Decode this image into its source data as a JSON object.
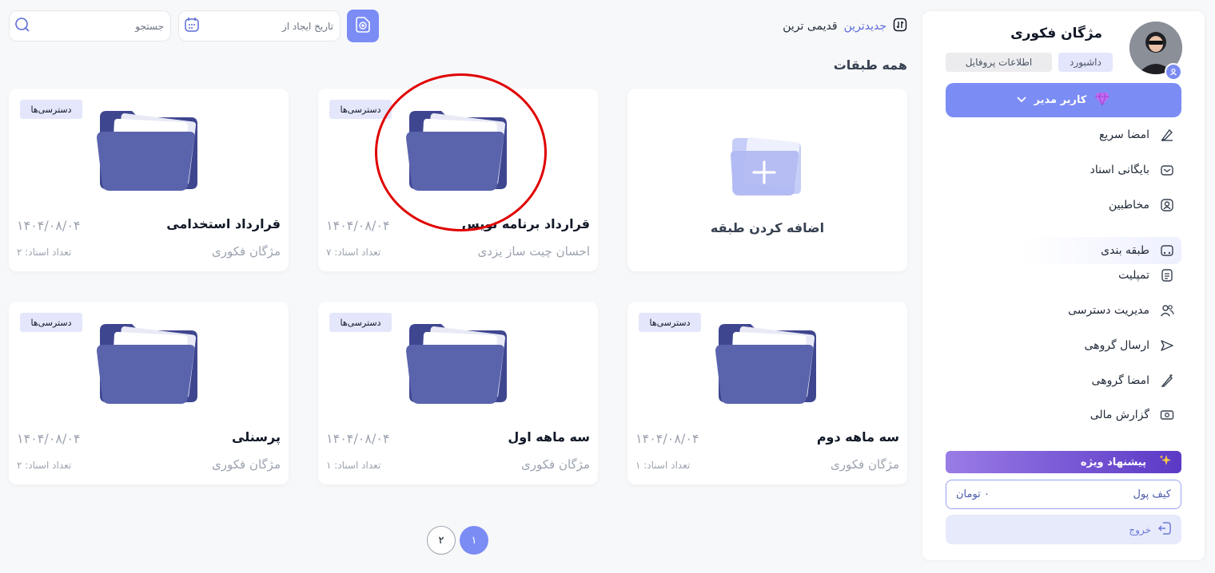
{
  "sidebar": {
    "user_name": "مژگان فکوری",
    "pill_dashboard": "داشبورد",
    "pill_profile": "اطلاعات پروفایل",
    "admin_label": "کاربر مدیر",
    "menu": [
      {
        "label": "امضا سریع",
        "icon": "signature-icon"
      },
      {
        "label": "بایگانی اسناد",
        "icon": "archive-icon"
      },
      {
        "label": "مخاطبین",
        "icon": "contacts-icon"
      },
      {
        "label": "طبقه بندی",
        "icon": "category-icon",
        "active": true
      },
      {
        "label": "تمپلیت",
        "icon": "template-icon"
      },
      {
        "label": "مدیریت دسترسی",
        "icon": "users-icon"
      },
      {
        "label": "ارسال گروهی",
        "icon": "send-icon"
      },
      {
        "label": "امضا گروهی",
        "icon": "group-sign-icon"
      },
      {
        "label": "گزارش مالی",
        "icon": "money-icon"
      }
    ],
    "offer_label": "پیشنهاد ویژه",
    "wallet_label": "کیف پول",
    "wallet_value": "۰ تومان",
    "logout_label": "خروج"
  },
  "toolbar": {
    "search_placeholder": "جستجو",
    "date_placeholder": "تاریخ ایجاد از",
    "sort_newest": "جدیدترین",
    "sort_oldest": "قدیمی ترین"
  },
  "section_title": "همه طبقات",
  "add_card_label": "اضافه کردن طبقه",
  "badge_label": "دسترسی‌ها",
  "cards": [
    {
      "title": "قرارداد استخدامی",
      "date": "۱۴۰۴/۰۸/۰۴",
      "owner": "مژگان فکوری",
      "count": "تعداد اسناد: ۲"
    },
    {
      "title": "قرارداد برنامه نویس",
      "date": "۱۴۰۴/۰۸/۰۴",
      "owner": "احسان چیت ساز یزدی",
      "count": "تعداد اسناد: ۷"
    },
    {
      "title": "پرسنلی",
      "date": "۱۴۰۴/۰۸/۰۴",
      "owner": "مژگان فکوری",
      "count": "تعداد اسناد: ۲"
    },
    {
      "title": "سه ماهه اول",
      "date": "۱۴۰۴/۰۸/۰۴",
      "owner": "مژگان فکوری",
      "count": "تعداد اسناد: ۱"
    },
    {
      "title": "سه ماهه دوم",
      "date": "۱۴۰۴/۰۸/۰۴",
      "owner": "مژگان فکوری",
      "count": "تعداد اسناد: ۱"
    }
  ],
  "pagination": {
    "page1": "۱",
    "page2": "۲"
  },
  "colors": {
    "accent": "#7b8cf5",
    "folder": "#5a64ad",
    "annotation": "#e00000"
  }
}
